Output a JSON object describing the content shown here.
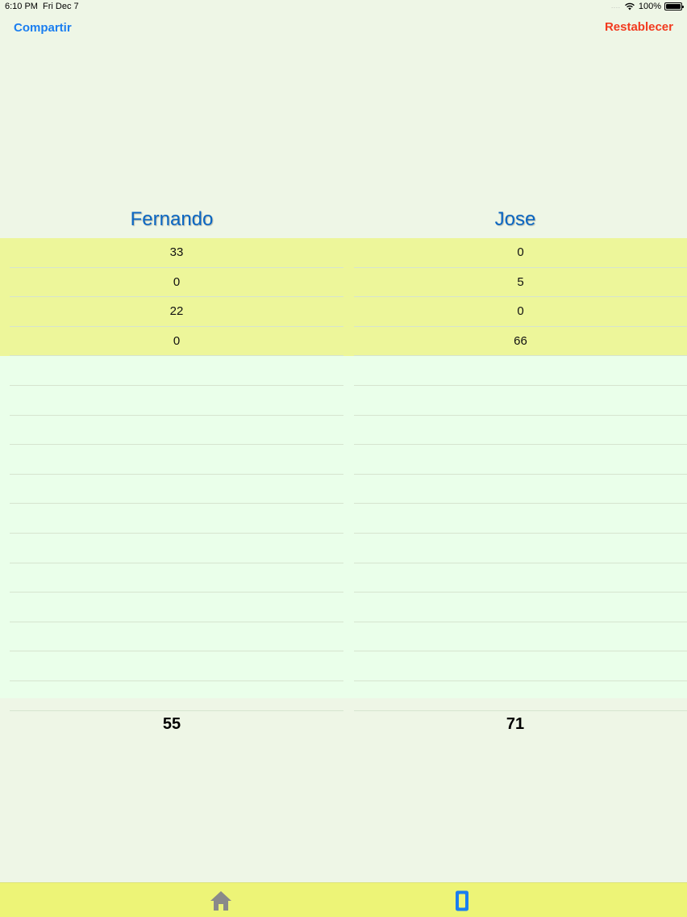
{
  "status_bar": {
    "time": "6:10 PM",
    "date": "Fri Dec 7",
    "signal": "....",
    "battery_label": "100%",
    "battery_level": 1.0
  },
  "nav": {
    "share_label": "Compartir",
    "reset_label": "Restablecer"
  },
  "players": [
    {
      "name": "Fernando",
      "scores": [
        "33",
        "0",
        "22",
        "0",
        "",
        "",
        "",
        "",
        "",
        "",
        "",
        "",
        "",
        "",
        "",
        ""
      ],
      "total": "55"
    },
    {
      "name": "Jose",
      "scores": [
        "0",
        "5",
        "0",
        "66",
        "",
        "",
        "",
        "",
        "",
        "",
        "",
        "",
        "",
        "",
        "",
        ""
      ],
      "total": "71"
    }
  ],
  "tabs": [
    {
      "icon": "home-icon",
      "color": "#8a8a8a"
    },
    {
      "icon": "device-icon",
      "color": "#1a7ef0"
    }
  ],
  "colors": {
    "background": "#eef6e6",
    "filled_row": "#edf69a",
    "empty_area": "#eaffea",
    "accent_blue": "#1a7ef0",
    "accent_red": "#f23a1f",
    "name_blue": "#0a66c2",
    "tab_bar": "#edf477"
  }
}
